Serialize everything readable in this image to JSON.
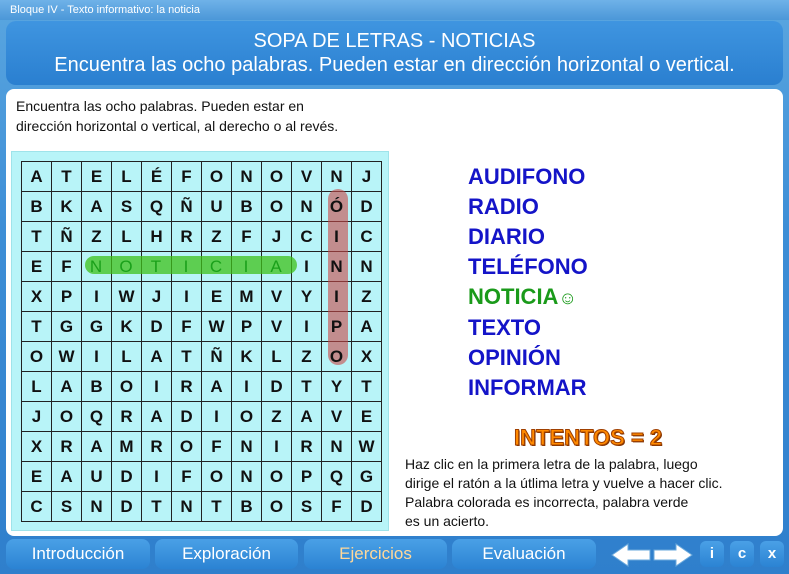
{
  "window": {
    "title": "Bloque IV - Texto informativo: la noticia"
  },
  "header": {
    "title": "SOPA DE LETRAS - NOTICIAS",
    "subtitle": "Encuentra las ocho palabras. Pueden estar en dirección horizontal o vertical."
  },
  "instructions": {
    "line1": "Encuentra las ocho palabras. Pueden estar en",
    "line2": "dirección horizontal o vertical, al derecho o al revés."
  },
  "grid": [
    [
      "A",
      "T",
      "E",
      "L",
      "É",
      "F",
      "O",
      "N",
      "O",
      "V",
      "N",
      "J"
    ],
    [
      "B",
      "K",
      "A",
      "S",
      "Q",
      "Ñ",
      "U",
      "B",
      "O",
      "N",
      "Ó",
      "D"
    ],
    [
      "T",
      "Ñ",
      "Z",
      "L",
      "H",
      "R",
      "Z",
      "F",
      "J",
      "C",
      "I",
      "C"
    ],
    [
      "E",
      "F",
      "N",
      "O",
      "T",
      "I",
      "C",
      "I",
      "A",
      "I",
      "N",
      "N"
    ],
    [
      "X",
      "P",
      "I",
      "W",
      "J",
      "I",
      "E",
      "M",
      "V",
      "Y",
      "I",
      "Z"
    ],
    [
      "T",
      "G",
      "G",
      "K",
      "D",
      "F",
      "W",
      "P",
      "V",
      "I",
      "P",
      "A"
    ],
    [
      "O",
      "W",
      "I",
      "L",
      "A",
      "T",
      "Ñ",
      "K",
      "L",
      "Z",
      "O",
      "X"
    ],
    [
      "L",
      "A",
      "B",
      "O",
      "I",
      "R",
      "A",
      "I",
      "D",
      "T",
      "Y",
      "T"
    ],
    [
      "J",
      "O",
      "Q",
      "R",
      "A",
      "D",
      "I",
      "O",
      "Z",
      "A",
      "V",
      "E"
    ],
    [
      "X",
      "R",
      "A",
      "M",
      "R",
      "O",
      "F",
      "N",
      "I",
      "R",
      "N",
      "W"
    ],
    [
      "E",
      "A",
      "U",
      "D",
      "I",
      "F",
      "O",
      "N",
      "O",
      "P",
      "Q",
      "G"
    ],
    [
      "C",
      "S",
      "N",
      "D",
      "T",
      "N",
      "T",
      "B",
      "O",
      "S",
      "F",
      "D"
    ]
  ],
  "words": [
    {
      "label": "AUDIFONO",
      "found": false
    },
    {
      "label": "RADIO",
      "found": false
    },
    {
      "label": "DIARIO",
      "found": false
    },
    {
      "label": "TELÉFONO",
      "found": false
    },
    {
      "label": "NOTICIA",
      "found": true
    },
    {
      "label": "TEXTO",
      "found": false
    },
    {
      "label": "OPINIÓN",
      "found": false
    },
    {
      "label": "INFORMAR",
      "found": false
    }
  ],
  "found_mark": "☺",
  "intentos": "INTENTOS = 2",
  "help": {
    "line1": "Haz clic en la primera letra de la palabra, luego",
    "line2": "dirige el ratón a la útlima letra y vuelve a hacer clic.",
    "line3": "Palabra colorada es incorrecta, palabra verde",
    "line4": "es un acierto."
  },
  "nav": {
    "intro": "Introducción",
    "explore": "Exploración",
    "exercises": "Ejercicios",
    "evaluation": "Evaluación",
    "info": "i",
    "credits": "c",
    "close": "x"
  },
  "colors": {
    "word_pending": "#1414c8",
    "word_found": "#1a9a1a",
    "intentos": "#ff8a00"
  }
}
